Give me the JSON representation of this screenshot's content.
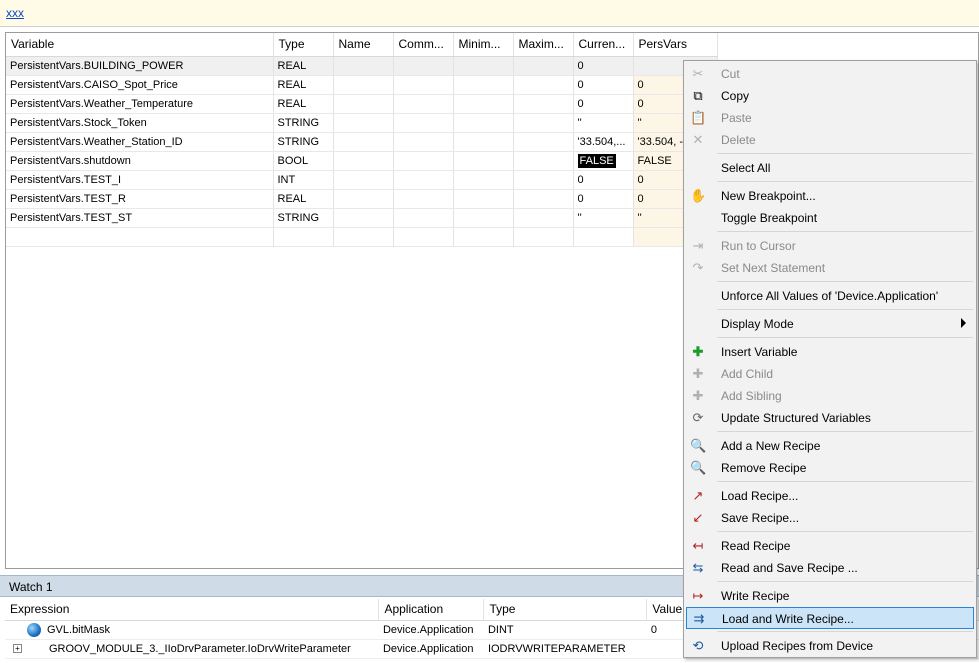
{
  "topbar": {
    "text": "xxx"
  },
  "grid": {
    "columns": [
      "Variable",
      "Type",
      "Name",
      "Comm...",
      "Minim...",
      "Maxim...",
      "Curren...",
      "PersVars"
    ],
    "rows": [
      {
        "variable": "PersistentVars.BUILDING_POWER",
        "type": "REAL",
        "current": "0",
        "pers": ""
      },
      {
        "variable": "PersistentVars.CAISO_Spot_Price",
        "type": "REAL",
        "current": "0",
        "pers": "0"
      },
      {
        "variable": "PersistentVars.Weather_Temperature",
        "type": "REAL",
        "current": "0",
        "pers": "0"
      },
      {
        "variable": "PersistentVars.Stock_Token",
        "type": "STRING",
        "current": "''",
        "pers": "''"
      },
      {
        "variable": "PersistentVars.Weather_Station_ID",
        "type": "STRING",
        "current": "'33.504,...",
        "pers": "'33.504, -"
      },
      {
        "variable": "PersistentVars.shutdown",
        "type": "BOOL",
        "current": "FALSE",
        "pers": "FALSE"
      },
      {
        "variable": "PersistentVars.TEST_I",
        "type": "INT",
        "current": "0",
        "pers": "0"
      },
      {
        "variable": "PersistentVars.TEST_R",
        "type": "REAL",
        "current": "0",
        "pers": "0"
      },
      {
        "variable": "PersistentVars.TEST_ST",
        "type": "STRING",
        "current": "''",
        "pers": "''"
      }
    ]
  },
  "watch": {
    "title": "Watch 1",
    "columns": [
      "Expression",
      "Application",
      "Type",
      "Value"
    ],
    "rows": [
      {
        "expression": "GVL.bitMask",
        "application": "Device.Application",
        "type": "DINT",
        "value": "0"
      },
      {
        "expression": "GROOV_MODULE_3._IIoDrvParameter.IoDrvWriteParameter",
        "application": "Device.Application",
        "type": "IODRVWRITEPARAMETER",
        "value": ""
      }
    ]
  },
  "context_menu": {
    "items": {
      "cut": "Cut",
      "copy": "Copy",
      "paste": "Paste",
      "delete": "Delete",
      "select_all": "Select All",
      "new_breakpoint": "New Breakpoint...",
      "toggle_breakpoint": "Toggle Breakpoint",
      "run_to_cursor": "Run to Cursor",
      "set_next_statement": "Set Next Statement",
      "unforce_all": "Unforce All Values of 'Device.Application'",
      "display_mode": "Display Mode",
      "insert_variable": "Insert Variable",
      "add_child": "Add Child",
      "add_sibling": "Add Sibling",
      "update_structured": "Update Structured Variables",
      "add_recipe": "Add a New Recipe",
      "remove_recipe": "Remove Recipe",
      "load_recipe": "Load Recipe...",
      "save_recipe": "Save Recipe...",
      "read_recipe": "Read Recipe",
      "read_save_recipe": "Read and Save Recipe ...",
      "write_recipe": "Write Recipe",
      "load_write_recipe": "Load and Write Recipe...",
      "upload_recipes": "Upload Recipes from Device"
    }
  },
  "colors": {
    "highlight": "#cce4f7",
    "highlight_border": "#2b82d9",
    "watch_header": "#cfdbe6",
    "persvars_bg": "#fdf6e6"
  }
}
